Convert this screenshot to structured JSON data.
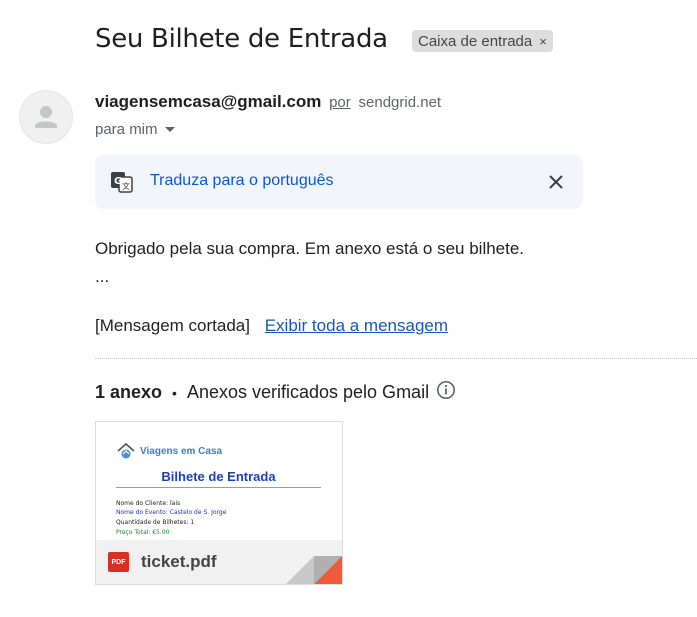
{
  "email": {
    "subject": "Seu Bilhete de Entrada",
    "label": "Caixa de entrada",
    "label_remove": "×",
    "sender_email": "viagensemcasa@gmail.com",
    "via_label": "por",
    "via_domain": "sendgrid.net",
    "recipient": "para mim",
    "translate_link": "Traduza para o português",
    "body_line1": "Obrigado pela sua compra. Em anexo está o seu bilhete.",
    "body_line2": "...",
    "clipped_text": "[Mensagem cortada]",
    "view_full": "Exibir toda a mensagem"
  },
  "attachments": {
    "count": "1 anexo",
    "separator": "•",
    "verified": "Anexos verificados pelo Gmail",
    "file": {
      "name": "ticket.pdf",
      "type_badge": "PDF",
      "preview": {
        "brand": "Viagens em Casa",
        "title": "Bilhete de Entrada",
        "line1": "Nome do Cliente: lais",
        "line2": "Nome do Evento: Castelo de S. Jorge",
        "line3": "Quantidade de Bilhetes: 1",
        "line4": "Preço Total: €5.00"
      }
    }
  },
  "colors": {
    "link": "#0b57d0",
    "pdf_red": "#d93025",
    "translate_bg": "#f2f6fc"
  }
}
